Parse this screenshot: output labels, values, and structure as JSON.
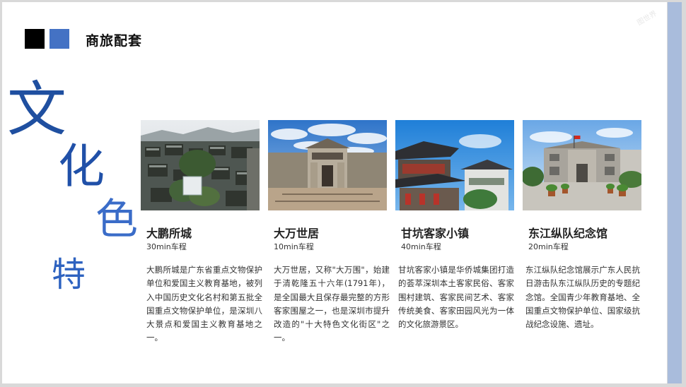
{
  "header": {
    "title": "商旅配套"
  },
  "watermark": "图世界",
  "side_title": {
    "chars": [
      "文",
      "化",
      "色",
      "特"
    ]
  },
  "cards": [
    {
      "name": "大鹏所城",
      "time": "30min车程",
      "desc": "大鹏所城是广东省重点文物保护单位和爱国主义教育基地，被列入中国历史文化名村和第五批全国重点文物保护单位，是深圳八大景点和爱国主义教育基地之一。",
      "photo": "aerial-old-town-photo"
    },
    {
      "name": "大万世居",
      "time": "10min车程",
      "desc": "大万世居，又称\"大万围\"，始建于清乾隆五十六年(1791年)，是全国最大且保存最完整的方形客家围屋之一，也是深圳市提升改造的\"十大特色文化街区\"之一。",
      "photo": "hakka-walled-house-photo"
    },
    {
      "name": "甘坑客家小镇",
      "time": "40min车程",
      "desc": "甘坑客家小镇是华侨城集团打造的荟萃深圳本土客家民俗、客家围村建筑、客家民间艺术、客家传统美食、客家田园风光为一体的文化旅游景区。",
      "photo": "hakka-town-pavilion-photo"
    },
    {
      "name": "东江纵队纪念馆",
      "time": "20min车程",
      "desc": "东江纵队纪念馆展示广东人民抗日游击队东江纵队历史的专题纪念馆。全国青少年教育基地、全国重点文物保护单位、国家级抗战纪念设施、遗址。",
      "photo": "memorial-hall-photo"
    }
  ],
  "colors": {
    "accent_blue": "#4472c4",
    "title_blue": "#1f4fa0",
    "side_bar": "#a9bcdc"
  }
}
